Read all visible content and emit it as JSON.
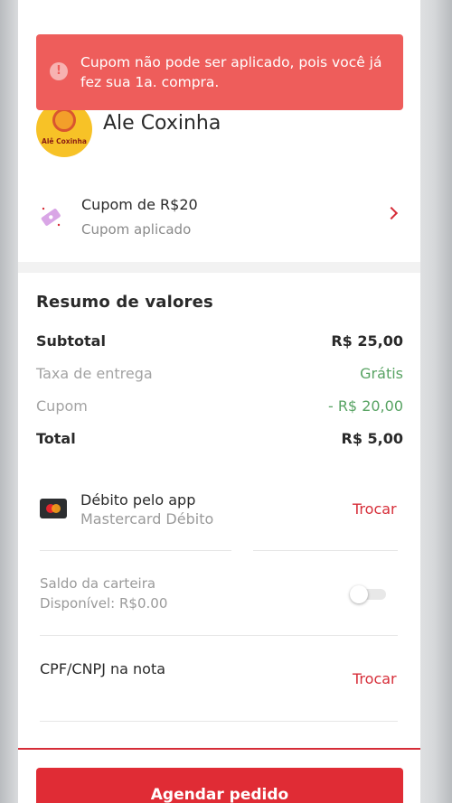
{
  "toast": {
    "icon": "alert-circle-icon",
    "message": "Cupom não pode ser aplicado, pois você já fez sua 1a. compra."
  },
  "store": {
    "logo_text": "Alê Coxinha",
    "name": "Ale Coxinha"
  },
  "coupon": {
    "title": "Cupom de R$20",
    "status": "Cupom aplicado",
    "icon": "coupon-ticket-icon"
  },
  "summary": {
    "title": "Resumo de valores",
    "rows": [
      {
        "label": "Subtotal",
        "value": "R$ 25,00"
      },
      {
        "label": "Taxa de entrega",
        "value": "Grátis"
      },
      {
        "label": "Cupom",
        "value": "- R$ 20,00"
      },
      {
        "label": "Total",
        "value": "R$ 5,00"
      }
    ]
  },
  "payment": {
    "method": "Débito pelo app",
    "card": "Mastercard Débito",
    "change_label": "Trocar",
    "icon": "mastercard-icon"
  },
  "wallet": {
    "title": "Saldo da carteira",
    "available": "Disponível: R$0.00",
    "enabled": false
  },
  "cpf": {
    "title": "CPF/CNPJ na nota",
    "change_label": "Trocar"
  },
  "cta": {
    "label": "Agendar pedido"
  },
  "colors": {
    "toast": "#ee5d5b",
    "accent_red": "#d62d38",
    "green": "#58a363"
  }
}
